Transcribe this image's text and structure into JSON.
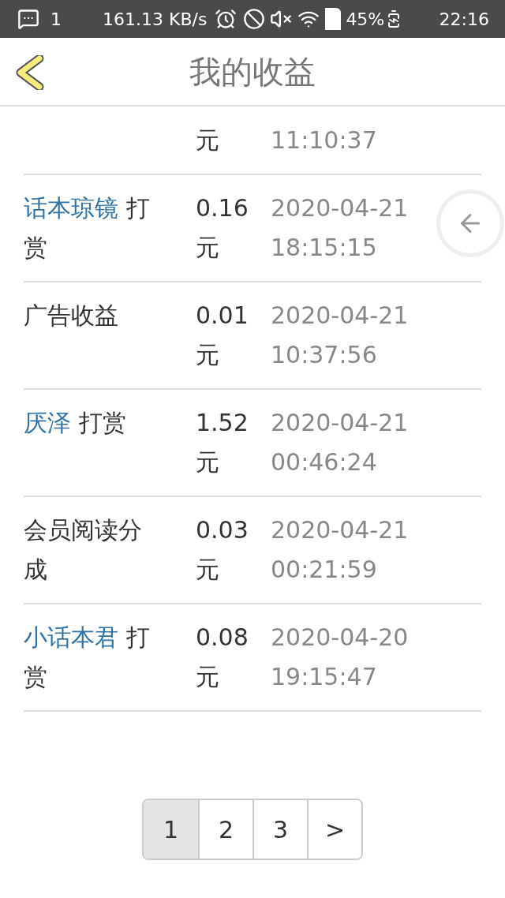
{
  "status_bar": {
    "notification_count": "1",
    "speed": "161.13 KB/s",
    "battery": "45%",
    "time": "22:16"
  },
  "header": {
    "title": "我的收益"
  },
  "records": [
    {
      "kind": "partial",
      "amount_unit": "元",
      "time": "11:10:37"
    },
    {
      "kind": "reward",
      "user": "话本琼镜",
      "action": "打赏",
      "amount": "0.16",
      "unit": "元",
      "date": "2020-04-21",
      "time": "18:15:15"
    },
    {
      "kind": "plain",
      "text": "广告收益",
      "amount": "0.01",
      "unit": "元",
      "date": "2020-04-21",
      "time": "10:37:56"
    },
    {
      "kind": "reward",
      "user": "厌泽",
      "action": "打赏",
      "amount": "1.52",
      "unit": "元",
      "date": "2020-04-21",
      "time": "00:46:24"
    },
    {
      "kind": "plain",
      "text": "会员阅读分成",
      "amount": "0.03",
      "unit": "元",
      "date": "2020-04-21",
      "time": "00:21:59"
    },
    {
      "kind": "reward",
      "user": "小话本君",
      "action": "打赏",
      "amount": "0.08",
      "unit": "元",
      "date": "2020-04-20",
      "time": "19:15:47"
    }
  ],
  "pagination": [
    {
      "label": "1",
      "selected": true
    },
    {
      "label": "2",
      "selected": false
    },
    {
      "label": "3",
      "selected": false
    },
    {
      "label": ">",
      "selected": false
    }
  ]
}
